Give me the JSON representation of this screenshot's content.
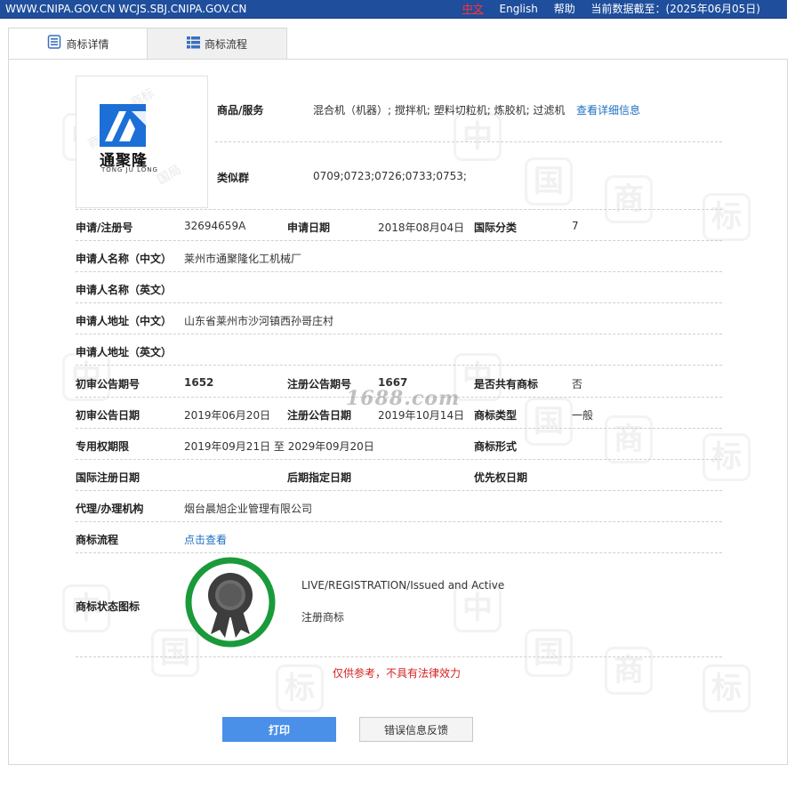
{
  "topbar": {
    "site": "WWW.CNIPA.GOV.CN WCJS.SBJ.CNIPA.GOV.CN",
    "lang_zh": "中文",
    "lang_en": "English",
    "help": "帮助",
    "data_date": "当前数据截至：(2025年06月05日)"
  },
  "tabs": [
    {
      "label": "商标详情",
      "icon": "document-icon"
    },
    {
      "label": "商标流程",
      "icon": "list-icon"
    }
  ],
  "logo": {
    "brand_cn": "通聚隆",
    "brand_en": "TONG JU LONG",
    "accent": "#1b6fd6"
  },
  "goods": {
    "label": "商品/服务",
    "value": "混合机（机器）; 搅拌机; 塑料切粒机; 炼胶机; 过滤机",
    "link": "查看详细信息"
  },
  "similar": {
    "label": "类似群",
    "value": "0709;0723;0726;0733;0753;"
  },
  "fields": {
    "reg_no_label": "申请/注册号",
    "reg_no": "32694659A",
    "app_date_label": "申请日期",
    "app_date": "2018年08月04日",
    "intl_class_label": "国际分类",
    "intl_class": "7",
    "applicant_cn_label": "申请人名称（中文）",
    "applicant_cn": "莱州市通聚隆化工机械厂",
    "applicant_en_label": "申请人名称（英文）",
    "applicant_en": "",
    "address_cn_label": "申请人地址（中文）",
    "address_cn": "山东省莱州市沙河镇西孙哥庄村",
    "address_en_label": "申请人地址（英文）",
    "address_en": "",
    "prelim_no_label": "初审公告期号",
    "prelim_no": "1652",
    "reg_pub_no_label": "注册公告期号",
    "reg_pub_no": "1667",
    "shared_label": "是否共有商标",
    "shared": "否",
    "prelim_date_label": "初审公告日期",
    "prelim_date": "2019年06月20日",
    "reg_pub_date_label": "注册公告日期",
    "reg_pub_date": "2019年10月14日",
    "tm_type_label": "商标类型",
    "tm_type": "一般",
    "term_label": "专用权期限",
    "term": "2019年09月21日 至 2029年09月20日",
    "tm_form_label": "商标形式",
    "tm_form": "",
    "intl_reg_date_label": "国际注册日期",
    "intl_reg_date": "",
    "later_designation_label": "后期指定日期",
    "later_designation": "",
    "priority_date_label": "优先权日期",
    "priority_date": "",
    "agent_label": "代理/办理机构",
    "agent": "烟台晨旭企业管理有限公司",
    "process_label": "商标流程",
    "process_link": "点击查看",
    "status_label": "商标状态图标",
    "status_en": "LIVE/REGISTRATION/Issued and Active",
    "status_cn": "注册商标"
  },
  "disclaimer": "仅供参考，不具有法律效力",
  "buttons": {
    "print": "打印",
    "feedback": "错误信息反馈"
  },
  "watermark": "1688.com",
  "colors": {
    "topbar": "#1f4e9c",
    "status_ring": "#1a9a3a",
    "print_button": "#4a90e8",
    "link": "#1c6fc2",
    "disclaimer": "#d42020"
  }
}
